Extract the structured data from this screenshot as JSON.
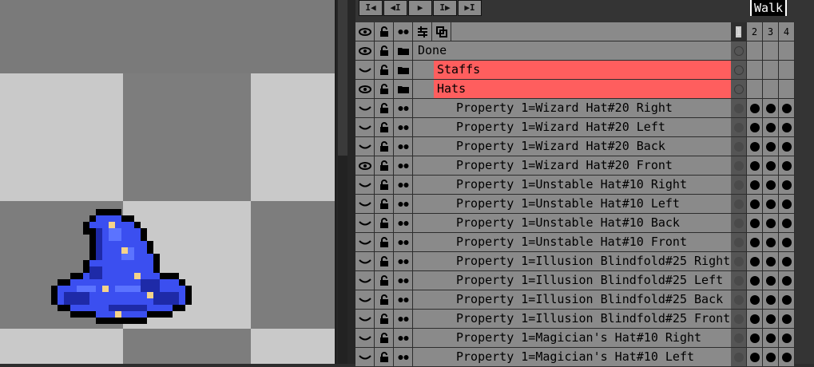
{
  "timeline": {
    "controls": [
      "I◀",
      "◀I",
      "▶",
      "I▶",
      "▶I"
    ],
    "tag_label": "Walk",
    "frame_numbers": [
      "1",
      "2",
      "3",
      "4"
    ],
    "header_icons": [
      "eye-icon",
      "lock-icon",
      "link-dots-icon",
      "layer-blend-icon",
      "duplicate-icon"
    ],
    "layers": [
      {
        "name": "Done",
        "visible": true,
        "type": "group",
        "indent": 0,
        "highlight": false,
        "cels": "empty"
      },
      {
        "name": "Staffs",
        "visible": false,
        "type": "group",
        "indent": 1,
        "highlight": true,
        "cels": "empty"
      },
      {
        "name": "Hats",
        "visible": true,
        "type": "group",
        "indent": 1,
        "highlight": true,
        "cels": "empty"
      },
      {
        "name": "Property 1=Wizard Hat#20 Right",
        "visible": false,
        "type": "layer",
        "indent": 2,
        "highlight": false,
        "cels": "full"
      },
      {
        "name": "Property 1=Wizard Hat#20 Left",
        "visible": false,
        "type": "layer",
        "indent": 2,
        "highlight": false,
        "cels": "full"
      },
      {
        "name": "Property 1=Wizard Hat#20 Back",
        "visible": false,
        "type": "layer",
        "indent": 2,
        "highlight": false,
        "cels": "full"
      },
      {
        "name": "Property 1=Wizard Hat#20 Front",
        "visible": true,
        "type": "layer",
        "indent": 2,
        "highlight": false,
        "cels": "full"
      },
      {
        "name": "Property 1=Unstable Hat#10 Right",
        "visible": false,
        "type": "layer",
        "indent": 2,
        "highlight": false,
        "cels": "full"
      },
      {
        "name": "Property 1=Unstable Hat#10 Left",
        "visible": false,
        "type": "layer",
        "indent": 2,
        "highlight": false,
        "cels": "full"
      },
      {
        "name": "Property 1=Unstable Hat#10 Back",
        "visible": false,
        "type": "layer",
        "indent": 2,
        "highlight": false,
        "cels": "full"
      },
      {
        "name": "Property 1=Unstable Hat#10 Front",
        "visible": false,
        "type": "layer",
        "indent": 2,
        "highlight": false,
        "cels": "full"
      },
      {
        "name": "Property 1=Illusion Blindfold#25 Right",
        "visible": false,
        "type": "layer",
        "indent": 2,
        "highlight": false,
        "cels": "full"
      },
      {
        "name": "Property 1=Illusion Blindfold#25 Left",
        "visible": false,
        "type": "layer",
        "indent": 2,
        "highlight": false,
        "cels": "full"
      },
      {
        "name": "Property 1=Illusion Blindfold#25 Back",
        "visible": false,
        "type": "layer",
        "indent": 2,
        "highlight": false,
        "cels": "full"
      },
      {
        "name": "Property 1=Illusion Blindfold#25 Front",
        "visible": false,
        "type": "layer",
        "indent": 2,
        "highlight": false,
        "cels": "full"
      },
      {
        "name": "Property 1=Magician's Hat#10 Right",
        "visible": false,
        "type": "layer",
        "indent": 2,
        "highlight": false,
        "cels": "full"
      },
      {
        "name": "Property 1=Magician's Hat#10 Left",
        "visible": false,
        "type": "layer",
        "indent": 2,
        "highlight": false,
        "cels": "full"
      }
    ]
  },
  "colors": {
    "group_highlight": "#ff5e5e",
    "hat_blue": "#3b4ff0",
    "hat_dark": "#1e2aa8",
    "star": "#f5d38a"
  }
}
